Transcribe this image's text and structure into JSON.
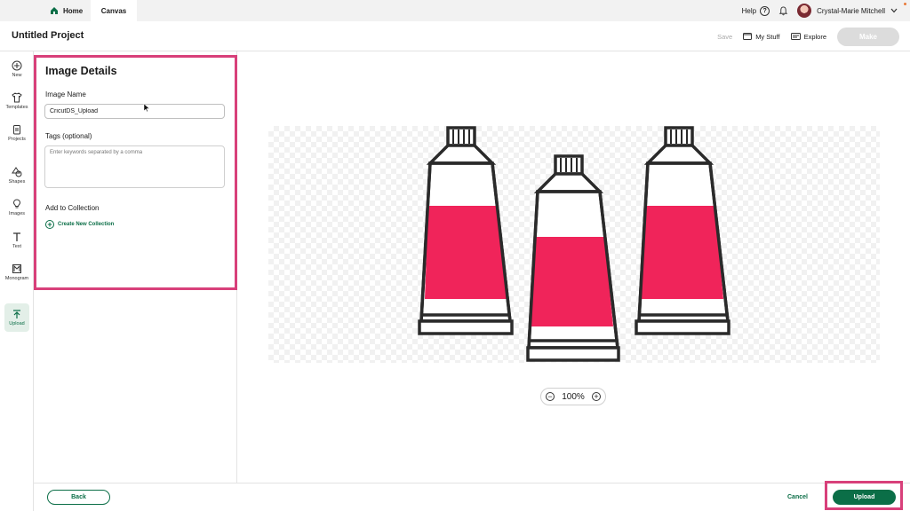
{
  "tabs": {
    "home": "Home",
    "canvas": "Canvas"
  },
  "topbar": {
    "help": "Help",
    "user_name": "Crystal-Marie Mitchell"
  },
  "header": {
    "title": "Untitled Project",
    "save": "Save",
    "my_stuff": "My Stuff",
    "explore": "Explore",
    "make": "Make"
  },
  "nav": {
    "new": "New",
    "templates": "Templates",
    "projects": "Projects",
    "shapes": "Shapes",
    "images": "Images",
    "text": "Text",
    "monogram": "Monogram",
    "upload": "Upload"
  },
  "panel": {
    "title": "Image Details",
    "image_name_label": "Image Name",
    "image_name_value": "CricutDS_Upload",
    "tags_label": "Tags (optional)",
    "tags_placeholder": "Enter keywords separated by a comma",
    "collection_label": "Add to Collection",
    "create_collection": "Create New Collection"
  },
  "canvas": {
    "zoom": "100%"
  },
  "footer": {
    "back": "Back",
    "cancel": "Cancel",
    "upload": "Upload"
  },
  "colors": {
    "brand_green": "#0b6e47",
    "highlight_pink": "#d8407a",
    "tube_red": "#f0245a"
  }
}
